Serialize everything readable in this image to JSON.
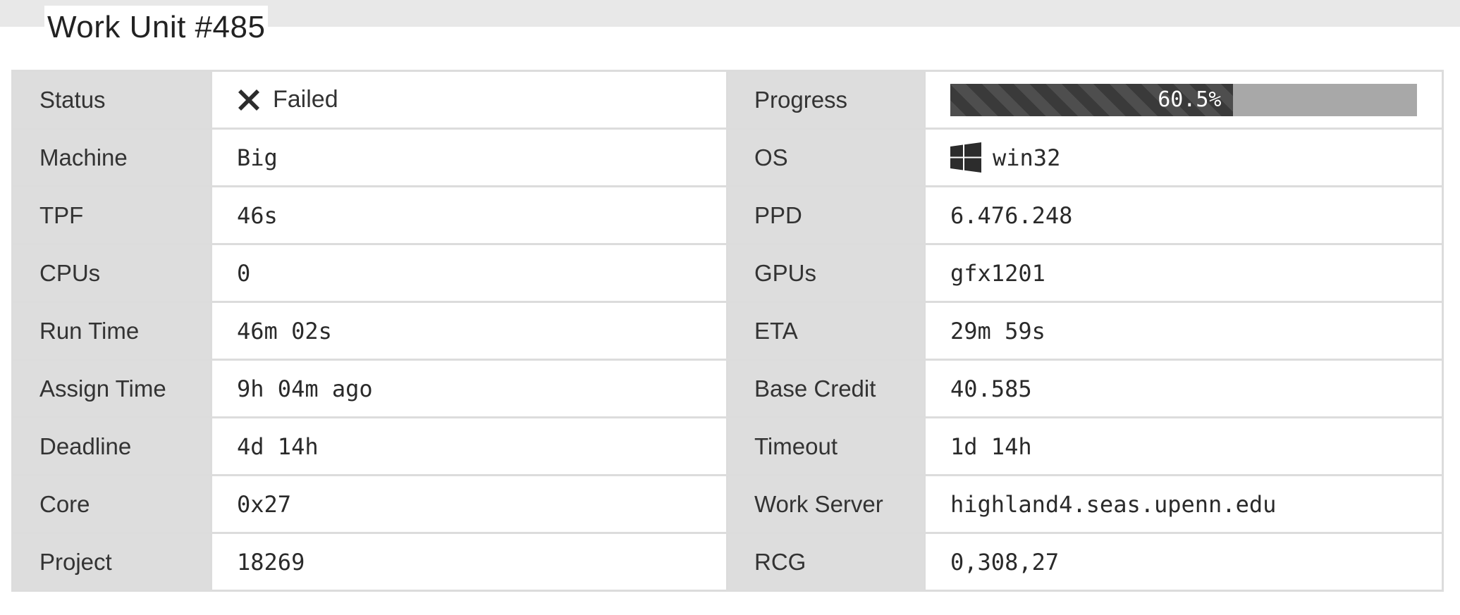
{
  "page": {
    "title": "Work Unit #485"
  },
  "progress": {
    "label": "Progress",
    "percent": 60.5,
    "text": "60.5%"
  },
  "status": {
    "label": "Status",
    "value": "Failed",
    "icon": "x-icon"
  },
  "os": {
    "label": "OS",
    "value": "win32",
    "icon": "windows-icon"
  },
  "rows": [
    {
      "left_label": "Machine",
      "left_value": "Big",
      "right_label": "OS",
      "right_value": "win32"
    },
    {
      "left_label": "TPF",
      "left_value": "46s",
      "right_label": "PPD",
      "right_value": "6.476.248"
    },
    {
      "left_label": "CPUs",
      "left_value": "0",
      "right_label": "GPUs",
      "right_value": "gfx1201"
    },
    {
      "left_label": "Run Time",
      "left_value": "46m 02s",
      "right_label": "ETA",
      "right_value": "29m 59s"
    },
    {
      "left_label": "Assign Time",
      "left_value": "9h 04m ago",
      "right_label": "Base Credit",
      "right_value": "40.585"
    },
    {
      "left_label": "Deadline",
      "left_value": "4d 14h",
      "right_label": "Timeout",
      "right_value": "1d 14h"
    },
    {
      "left_label": "Core",
      "left_value": "0x27",
      "right_label": "Work Server",
      "right_value": "highland4.seas.upenn.edu"
    },
    {
      "left_label": "Project",
      "left_value": "18269",
      "right_label": "RCG",
      "right_value": "0,308,27"
    }
  ],
  "colors": {
    "label_bg": "#dddddd",
    "progress_fill": "#3a3a3a",
    "progress_track": "#a8a8a8",
    "topband": "#e8e8e8"
  }
}
